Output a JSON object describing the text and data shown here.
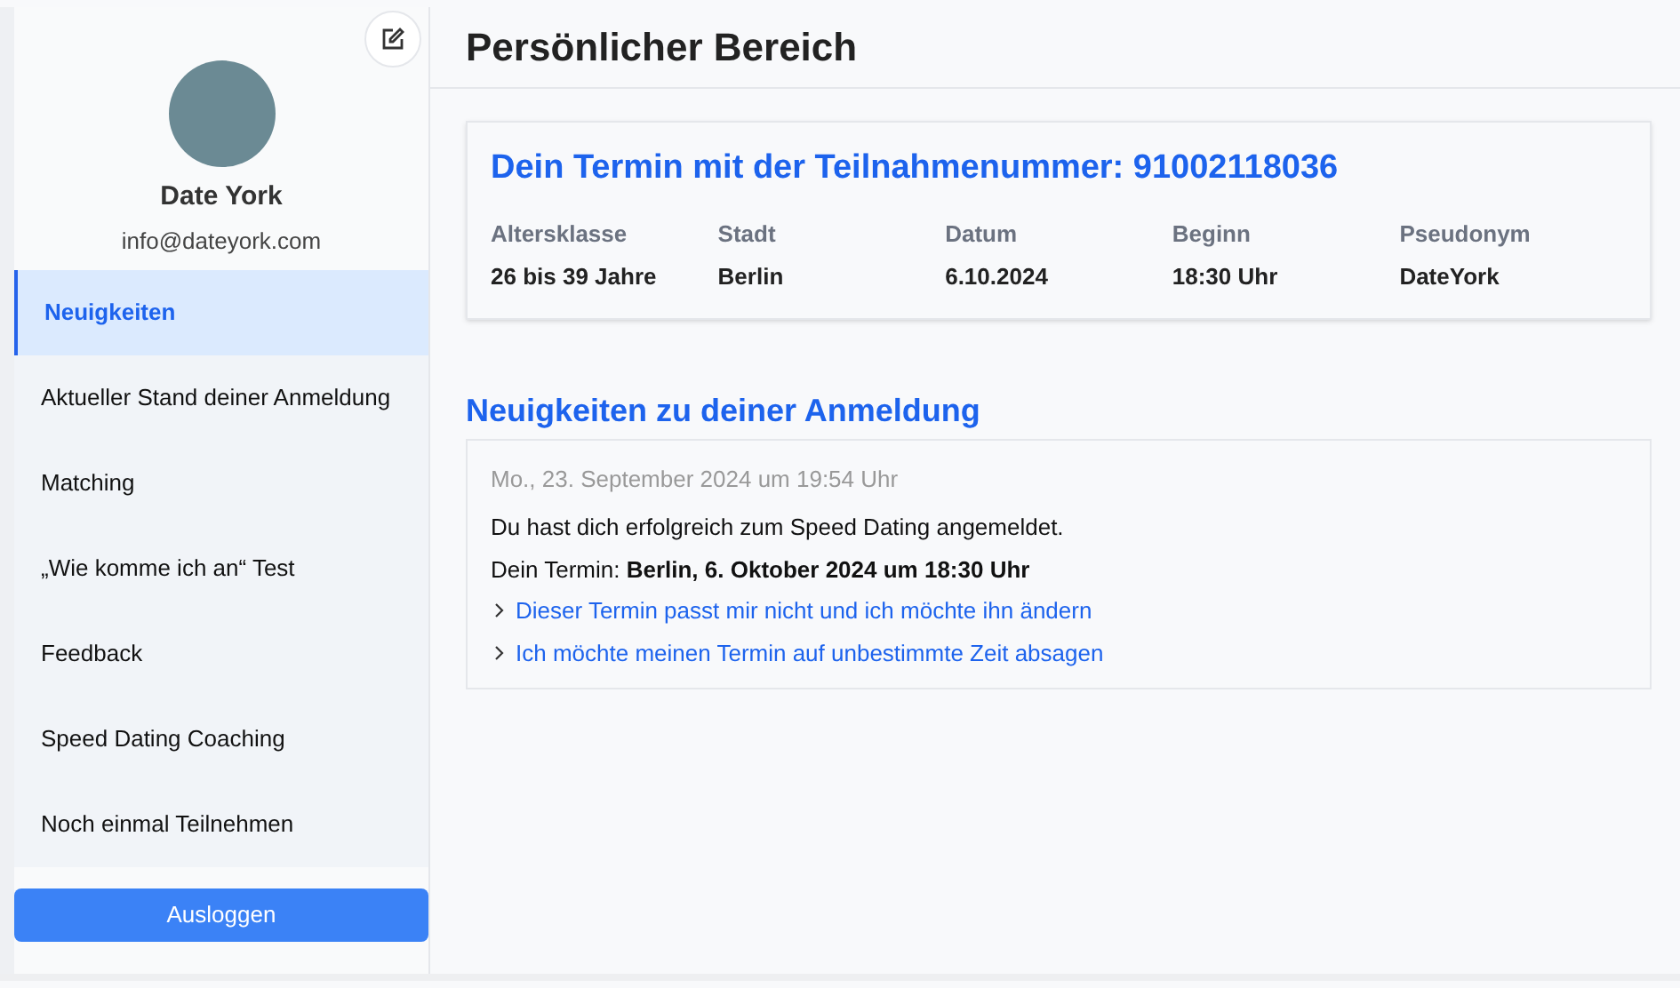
{
  "sidebar": {
    "user": {
      "name": "Date York",
      "email": "info@dateyork.com"
    },
    "items": [
      {
        "label": "Neuigkeiten",
        "selected": true
      },
      {
        "label": "Aktueller Stand deiner Anmeldung",
        "selected": false
      },
      {
        "label": "Matching",
        "selected": false
      },
      {
        "label": "„Wie komme ich an“ Test",
        "selected": false
      },
      {
        "label": "Feedback",
        "selected": false
      },
      {
        "label": "Speed Dating Coaching",
        "selected": false
      },
      {
        "label": "Noch einmal Teilnehmen",
        "selected": false
      }
    ],
    "logout": "Ausloggen"
  },
  "page_title": "Persönlicher Bereich",
  "appointment": {
    "heading": "Dein Termin mit der Teilnahmenummer: 91002118036",
    "fields": [
      {
        "label": "Altersklasse",
        "value": "26 bis 39 Jahre"
      },
      {
        "label": "Stadt",
        "value": "Berlin"
      },
      {
        "label": "Datum",
        "value": "6.10.2024"
      },
      {
        "label": "Beginn",
        "value": "18:30 Uhr"
      },
      {
        "label": "Pseudonym",
        "value": "DateYork"
      }
    ]
  },
  "news": {
    "heading": "Neuigkeiten zu deiner Anmeldung",
    "timestamp": "Mo., 23. September 2024 um 19:54 Uhr",
    "lines": [
      "Du hast dich erfolgreich zum Speed Dating angemeldet.",
      "Dein Termin: **Berlin, 6. Oktober 2024 um 18:30 Uhr**"
    ],
    "links": [
      "Dieser Termin passt mir nicht und ich möchte ihn ändern",
      "Ich möchte meinen Termin auf unbestimmte Zeit absagen"
    ]
  }
}
